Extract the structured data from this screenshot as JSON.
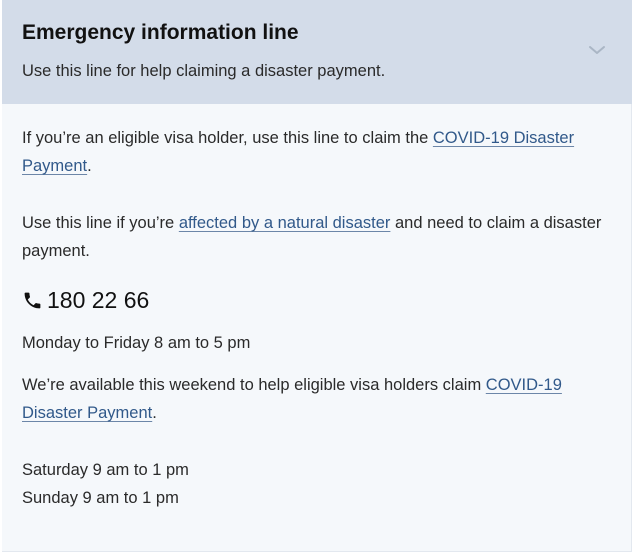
{
  "accordion": {
    "title": "Emergency information line",
    "subtitle": "Use this line for help claiming a disaster payment.",
    "toggle_icon": "chevron-down-icon",
    "expanded": true
  },
  "content": {
    "para1": {
      "before": "If you’re an eligible visa holder, use this line to claim the ",
      "link": "COVID-19 Disaster Payment",
      "after": "."
    },
    "para2": {
      "before": "Use this line if you’re ",
      "link": "affected by a natural disaster",
      "after": " and need to claim a disaster payment."
    },
    "phone": {
      "icon": "phone-icon",
      "number": "180 22 66"
    },
    "hours_weekday": "Monday to Friday 8 am to 5 pm",
    "para3": {
      "before": "We’re available this weekend to help eligible visa holders claim ",
      "link": "COVID-19 Disaster Payment",
      "after": "."
    },
    "hours_saturday": "Saturday 9 am to 1 pm",
    "hours_sunday": "Sunday 9 am to 1 pm"
  },
  "colors": {
    "header_bg": "#d3dce9",
    "body_bg": "#f5f8fb",
    "link": "#31598a"
  }
}
